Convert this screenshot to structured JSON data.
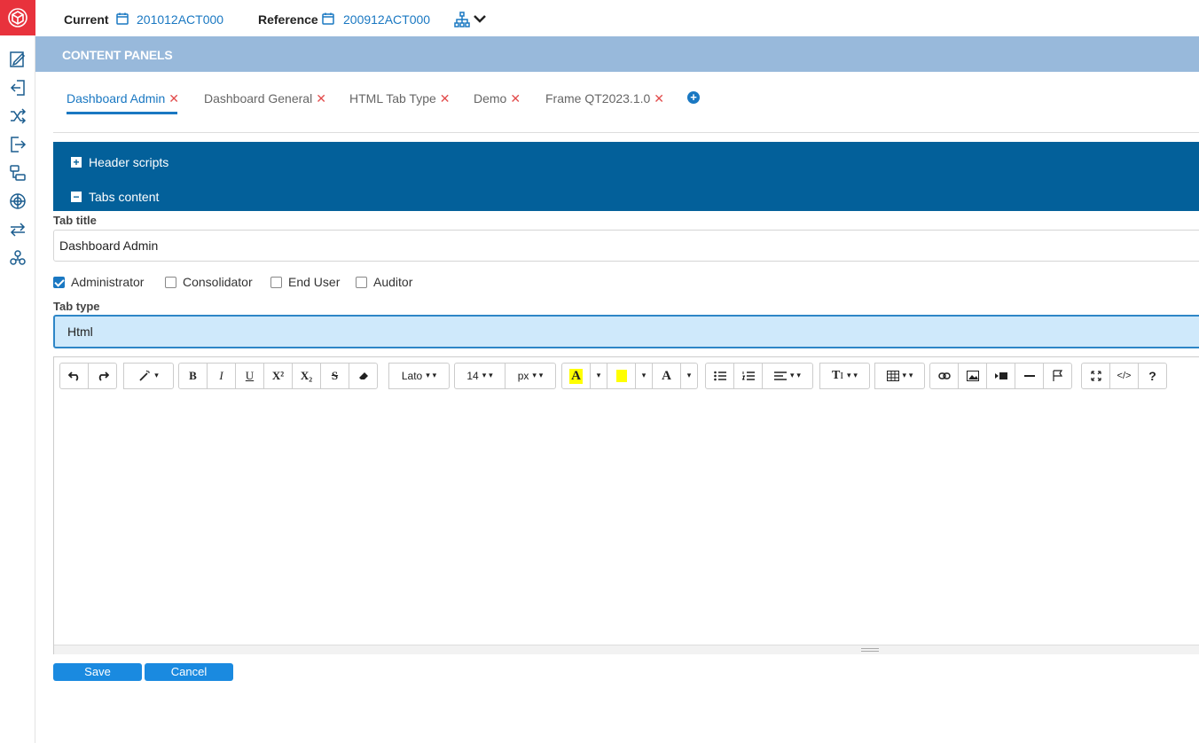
{
  "topbar": {
    "current_label": "Current",
    "current_value": "201012ACT000",
    "reference_label": "Reference",
    "reference_value": "200912ACT000"
  },
  "panel": {
    "title": "CONTENT PANELS"
  },
  "tabs": [
    {
      "label": "Dashboard Admin",
      "active": true
    },
    {
      "label": "Dashboard General",
      "active": false
    },
    {
      "label": "HTML Tab Type",
      "active": false
    },
    {
      "label": "Demo",
      "active": false
    },
    {
      "label": "Frame QT2023.1.0",
      "active": false
    }
  ],
  "tab_close_glyph": "✕",
  "tab_add_glyph": "+",
  "accordion": {
    "header_scripts": "Header scripts",
    "tabs_content": "Tabs content",
    "expand_glyph": "+",
    "collapse_glyph": "−"
  },
  "form": {
    "tab_title_label": "Tab title",
    "tab_title_value": "Dashboard Admin",
    "roles": [
      {
        "label": "Administrator",
        "checked": true
      },
      {
        "label": "Consolidator",
        "checked": false
      },
      {
        "label": "End User",
        "checked": false
      },
      {
        "label": "Auditor",
        "checked": false
      }
    ],
    "tab_type_label": "Tab type",
    "tab_type_value": "Html"
  },
  "toolbar": {
    "font_name": "Lato",
    "font_size": "14",
    "font_unit": "px",
    "bold": "B",
    "italic": "I",
    "underline": "U",
    "superscript": "X²",
    "subscript": "X₂",
    "strike": "S",
    "help": "?",
    "code": "</>"
  },
  "actions": {
    "save": "Save",
    "cancel": "Cancel"
  },
  "colors": {
    "accent": "#1a78c2",
    "brand_red": "#e8323c",
    "accordion_bg": "#03609a",
    "band_bg": "#98b9db",
    "select_bg": "#cfe9fb"
  }
}
